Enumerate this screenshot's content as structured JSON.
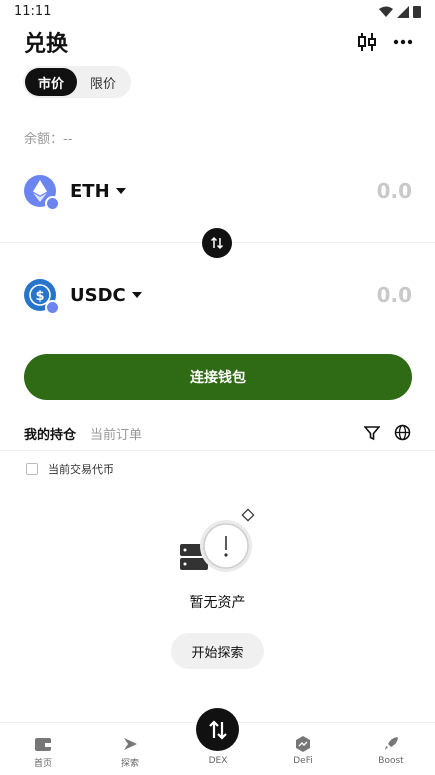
{
  "status_bar": {
    "time": "11:11"
  },
  "header": {
    "title": "兑换"
  },
  "order_tabs": [
    {
      "label": "市价",
      "active": true
    },
    {
      "label": "限价",
      "active": false
    }
  ],
  "balance": {
    "label": "余额：--"
  },
  "from_token": {
    "symbol": "ETH",
    "amount": "0.0",
    "icon": "eth-icon"
  },
  "to_token": {
    "symbol": "USDC",
    "amount": "0.0",
    "icon": "usdc-icon"
  },
  "connect_button": {
    "label": "连接钱包"
  },
  "holdings_tabs": [
    {
      "label": "我的持仓",
      "active": true
    },
    {
      "label": "当前订单",
      "active": false
    }
  ],
  "filter": {
    "label": "当前交易代币"
  },
  "empty_state": {
    "message": "暂无资产",
    "button": "开始探索"
  },
  "bottom_nav": [
    {
      "label": "首页",
      "icon": "wallet-icon"
    },
    {
      "label": "探索",
      "icon": "compass-icon"
    },
    {
      "label": "DEX",
      "icon": "swap-icon"
    },
    {
      "label": "DeFi",
      "icon": "defi-icon"
    },
    {
      "label": "Boost",
      "icon": "rocket-icon"
    }
  ],
  "colors": {
    "accent_green": "#2f6a14",
    "eth_blue": "#6b84f0",
    "usdc_blue": "#2775ca"
  }
}
